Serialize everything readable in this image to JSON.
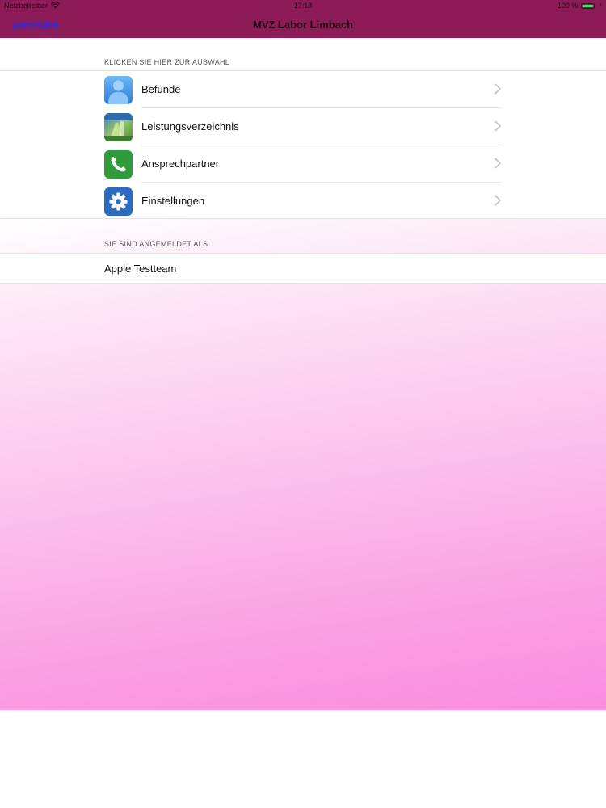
{
  "status_bar": {
    "carrier": "Netzbetreiber",
    "time": "17:18",
    "battery": "100 %",
    "battery_level": 1.0,
    "wifi_icon": "wifi-icon",
    "battery_icon": "battery-icon"
  },
  "nav": {
    "back_label": "abmelden",
    "title": "MVZ Labor Limbach"
  },
  "menu": {
    "section_title": "KLICKEN SIE HIER ZUR AUSWAHL",
    "items": [
      {
        "label": "Befunde",
        "icon": "person-icon"
      },
      {
        "label": "Leistungsverzeichnis",
        "icon": "lab-photo-icon"
      },
      {
        "label": "Ansprechpartner",
        "icon": "phone-icon"
      },
      {
        "label": "Einstellungen",
        "icon": "gear-icon"
      }
    ]
  },
  "user": {
    "section_title": "SIE SIND ANGEMELDET ALS",
    "name": "Apple Testteam"
  },
  "colors": {
    "header_bg": "#8c1b57",
    "back_link": "#1f2cff",
    "gradient_end": "#fb8ce0"
  }
}
